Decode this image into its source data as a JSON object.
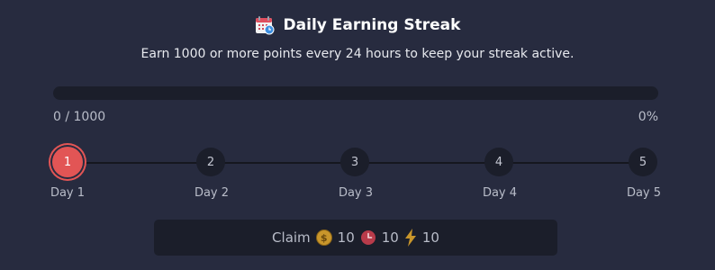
{
  "header": {
    "title": "Daily Earning Streak",
    "subtitle": "Earn 1000 or more points every 24 hours to keep your streak active."
  },
  "progress": {
    "count_text": "0 / 1000",
    "percent_text": "0%",
    "fraction": 0
  },
  "steps": [
    {
      "number": "1",
      "label": "Day 1",
      "active": true
    },
    {
      "number": "2",
      "label": "Day 2",
      "active": false
    },
    {
      "number": "3",
      "label": "Day 3",
      "active": false
    },
    {
      "number": "4",
      "label": "Day 4",
      "active": false
    },
    {
      "number": "5",
      "label": "Day 5",
      "active": false
    }
  ],
  "claim": {
    "label": "Claim",
    "rewards": [
      {
        "icon": "coin-icon",
        "amount": "10"
      },
      {
        "icon": "clock-icon",
        "amount": "10"
      },
      {
        "icon": "lightning-icon",
        "amount": "10"
      }
    ]
  },
  "colors": {
    "background": "#272b3f",
    "track": "#1b1e2a",
    "accent": "#e25555",
    "coin": "#c9962b"
  }
}
